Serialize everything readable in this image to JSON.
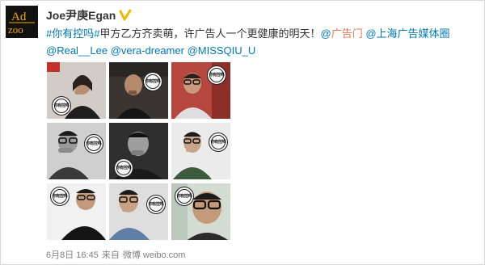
{
  "post": {
    "author": {
      "name": "Joe尹庚Egan",
      "avatar_text": [
        "Ad",
        "zoo"
      ],
      "verified_badge_color": "#f7b500"
    },
    "text": {
      "hashtag": "#你有控吗#",
      "body": "甲方乙方齐卖萌，许广告人一个更健康的明天！",
      "mentions_line1": [
        "@广告门",
        "@上海广告媒体圈"
      ],
      "mentions_line2": [
        "@Real__Lee",
        "@vera-dreamer",
        "@MISSQIU_U"
      ]
    },
    "badge_text": "你有控吗",
    "images": [
      {
        "label": "woman with hand on chin",
        "bg": "#c9c3bd"
      },
      {
        "label": "man in dark room",
        "bg": "#3a3431"
      },
      {
        "label": "man with glasses against red",
        "bg": "#b4473d"
      },
      {
        "label": "man with glasses B&W",
        "bg": "#cfcfcf"
      },
      {
        "label": "man dark background B&W",
        "bg": "#2e2e2e"
      },
      {
        "label": "man in green sweater",
        "bg": "#e9e9e9"
      },
      {
        "label": "man in black shirt",
        "bg": "#f1f1f1"
      },
      {
        "label": "man in blue shirt",
        "bg": "#dcdcdc"
      },
      {
        "label": "man with glasses teal background",
        "bg": "#cfd9cf"
      }
    ],
    "footer": {
      "date": "6月8日 16:45",
      "from_label": "来自",
      "source": "微博 weibo.com"
    }
  },
  "colors": {
    "mention_orange": "#eb7350",
    "link_blue": "#0078b6",
    "text_dark": "#333333",
    "meta_gray": "#808080"
  }
}
